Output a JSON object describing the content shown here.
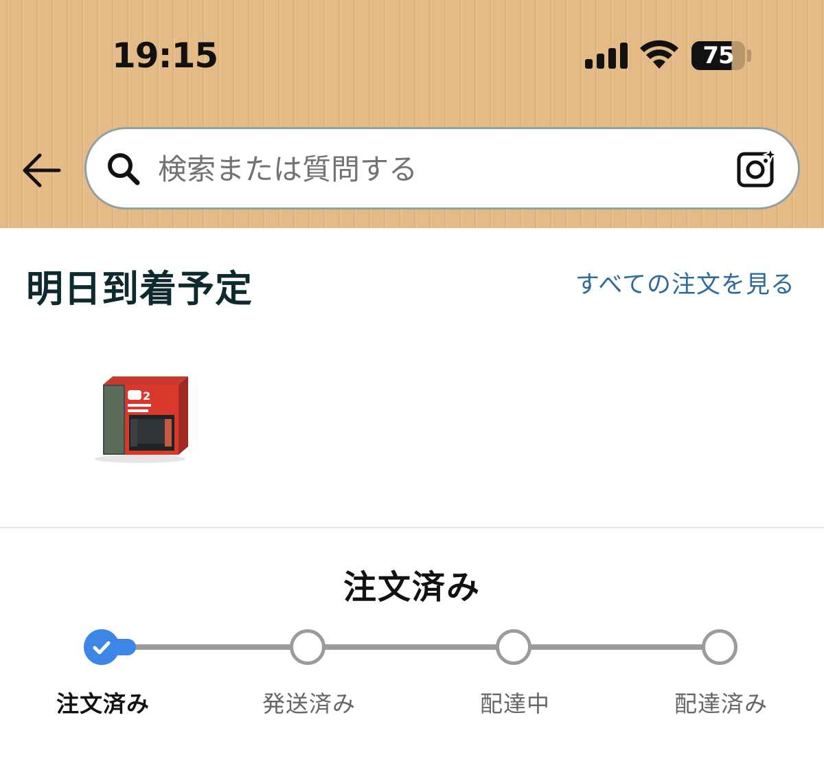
{
  "status_bar": {
    "time": "19:15",
    "battery": "75"
  },
  "search": {
    "placeholder": "検索または質問する"
  },
  "delivery": {
    "title": "明日到着予定",
    "see_all": "すべての注文を見る",
    "product_icon": "nintendo-switch-2-box"
  },
  "order_status": {
    "heading": "注文済み",
    "steps": [
      {
        "label": "注文済み",
        "state": "done"
      },
      {
        "label": "発送済み",
        "state": "pending"
      },
      {
        "label": "配達中",
        "state": "pending"
      },
      {
        "label": "配達済み",
        "state": "pending"
      }
    ],
    "progress_fraction": 0.0
  },
  "colors": {
    "header_bg": "#e4bb87",
    "link": "#2d6a9e",
    "progress_done": "#3b86e6",
    "progress_track": "#9b9b9b"
  }
}
